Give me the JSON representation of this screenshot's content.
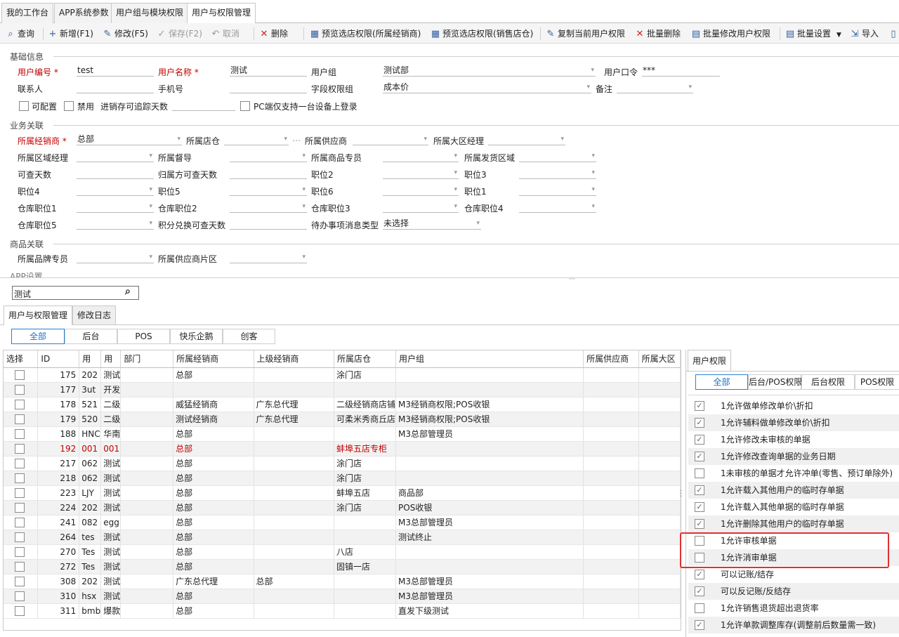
{
  "top_tabs": [
    "我的工作台",
    "APP系统参数",
    "用户组与模块权限",
    "用户与权限管理"
  ],
  "toolbar": {
    "query": "查询",
    "add": "新增(F1)",
    "edit": "修改(F5)",
    "save": "保存(F2)",
    "cancel": "取消",
    "delete": "删除",
    "preview_dealer": "预览选店权限(所属经销商)",
    "preview_store": "预览选店权限(销售店仓)",
    "copy_perm": "复制当前用户权限",
    "batch_delete": "批量删除",
    "batch_edit": "批量修改用户权限",
    "batch_settings": "批量设置",
    "import": "导入"
  },
  "basic": {
    "section": "基础信息",
    "user_code_label": "用户编号",
    "user_code_value": "test",
    "user_name_label": "用户名称",
    "user_name_value": "测试",
    "group_label": "用户组",
    "group_value": "测试部",
    "password_label": "用户口令",
    "password_value": "***",
    "contact_label": "联系人",
    "phone_label": "手机号",
    "field_perm_label": "字段权限组",
    "field_perm_value": "成本价",
    "remark_label": "备注",
    "configurable_label": "可配置",
    "disabled_label": "禁用",
    "trace_days_label": "进销存可追踪天数",
    "pc_single_label": "PC端仅支持一台设备上登录"
  },
  "business": {
    "section": "业务关联",
    "dealer_label": "所属经销商",
    "dealer_value": "总部",
    "store_label": "所属店仓",
    "supplier_label": "所属供应商",
    "region_mgr_label": "所属大区经理",
    "area_mgr_label": "所属区域经理",
    "supervisor_label": "所属督导",
    "goods_spec_label": "所属商品专员",
    "ship_area_label": "所属发货区域",
    "query_days_label": "可查天数",
    "store_query_days_label": "归属方可查天数",
    "pos2_label": "职位2",
    "pos3_label": "职位3",
    "pos4_label": "职位4",
    "pos5_label": "职位5",
    "pos6_label": "职位6",
    "pos1_label": "职位1",
    "wh_pos1_label": "仓库职位1",
    "wh_pos2_label": "仓库职位2",
    "wh_pos3_label": "仓库职位3",
    "wh_pos4_label": "仓库职位4",
    "wh_pos5_label": "仓库职位5",
    "points_days_label": "积分兑换可查天数",
    "todo_type_label": "待办事项消息类型",
    "todo_type_value": "未选择"
  },
  "goods": {
    "section": "商品关联",
    "brand_spec_label": "所属品牌专员",
    "supplier_area_label": "所属供应商片区"
  },
  "app_section": "APP设置",
  "search": {
    "value": "测试"
  },
  "lower_tabs": [
    "用户与权限管理",
    "修改日志"
  ],
  "filter_tabs": [
    "全部",
    "后台",
    "POS",
    "快乐企鹅",
    "创客"
  ],
  "grid": {
    "columns": [
      "选择",
      "ID",
      "用",
      "用",
      "部门",
      "所属经销商",
      "上级经销商",
      "所属店仓",
      "用户组",
      "所属供应商",
      "所属大区"
    ],
    "rows": [
      [
        "175",
        "202",
        "测试",
        "",
        "总部",
        "",
        "涂门店",
        "",
        false
      ],
      [
        "177",
        "3ut",
        "开发",
        "",
        "",
        "",
        "",
        "",
        false
      ],
      [
        "178",
        "521",
        "二级",
        "",
        "威猛经销商",
        "广东总代理",
        "二级经销商店铺",
        "M3经销商权限;POS收银",
        false
      ],
      [
        "179",
        "520",
        "二级",
        "",
        "测试经销商",
        "广东总代理",
        "可柔米秀商丘店",
        "M3经销商权限;POS收银",
        false
      ],
      [
        "188",
        "HNC",
        "华南",
        "",
        "总部",
        "",
        "",
        "M3总部管理员",
        false
      ],
      [
        "192",
        "001",
        "001",
        "",
        "总部",
        "",
        "蚌埠五店专柜",
        "",
        true
      ],
      [
        "217",
        "062",
        "测试",
        "",
        "总部",
        "",
        "涂门店",
        "",
        false
      ],
      [
        "218",
        "062",
        "测试",
        "",
        "总部",
        "",
        "涂门店",
        "",
        false
      ],
      [
        "223",
        "LJY",
        "测试",
        "",
        "总部",
        "",
        "蚌埠五店",
        "商品部",
        false
      ],
      [
        "224",
        "202",
        "测试",
        "",
        "总部",
        "",
        "涂门店",
        "POS收银",
        false
      ],
      [
        "241",
        "082",
        "egg",
        "",
        "总部",
        "",
        "",
        "M3总部管理员",
        false
      ],
      [
        "264",
        "tes",
        "测试",
        "",
        "总部",
        "",
        "",
        "测试终止",
        false
      ],
      [
        "270",
        "Tes",
        "测试",
        "",
        "总部",
        "",
        "八店",
        "",
        false
      ],
      [
        "272",
        "Tes",
        "测试",
        "",
        "总部",
        "",
        "固镇一店",
        "",
        false
      ],
      [
        "308",
        "202",
        "测试",
        "",
        "广东总代理",
        "总部",
        "",
        "M3总部管理员",
        false
      ],
      [
        "310",
        "hsx",
        "测试",
        "",
        "总部",
        "",
        "",
        "M3总部管理员",
        false
      ],
      [
        "311",
        "bmb",
        "爆款",
        "",
        "总部",
        "",
        "",
        "直发下级测试",
        false
      ]
    ]
  },
  "perm_panel": {
    "tab": "用户权限",
    "filters": [
      "全部",
      "后台/POS权限",
      "后台权限",
      "POS权限"
    ],
    "items": [
      {
        "label": "1允许做单修改单价\\折扣",
        "checked": true
      },
      {
        "label": "1允许辅料做单修改单价\\折扣",
        "checked": true
      },
      {
        "label": "1允许修改未审核的单据",
        "checked": true
      },
      {
        "label": "1允许修改查询单据的业务日期",
        "checked": true
      },
      {
        "label": "1未审核的单据才允许冲单(零售、预订单除外)",
        "checked": false
      },
      {
        "label": "1允许载入其他用户的临时存单据",
        "checked": true
      },
      {
        "label": "1允许载入其他单据的临时存单据",
        "checked": true
      },
      {
        "label": "1允许删除其他用户的临时存单据",
        "checked": true
      },
      {
        "label": "1允许审核单据",
        "checked": false
      },
      {
        "label": "1允许消审单据",
        "checked": false
      },
      {
        "label": "可以记账/结存",
        "checked": true
      },
      {
        "label": "可以反记账/反结存",
        "checked": true
      },
      {
        "label": "1允许销售退货超出退货率",
        "checked": false
      },
      {
        "label": "1允许单款调整库存(调整前后数量需一致)",
        "checked": true
      }
    ]
  },
  "colors": {
    "required": "#c00000",
    "accent": "#2a7fd4",
    "highlight_box": "#e03030"
  }
}
